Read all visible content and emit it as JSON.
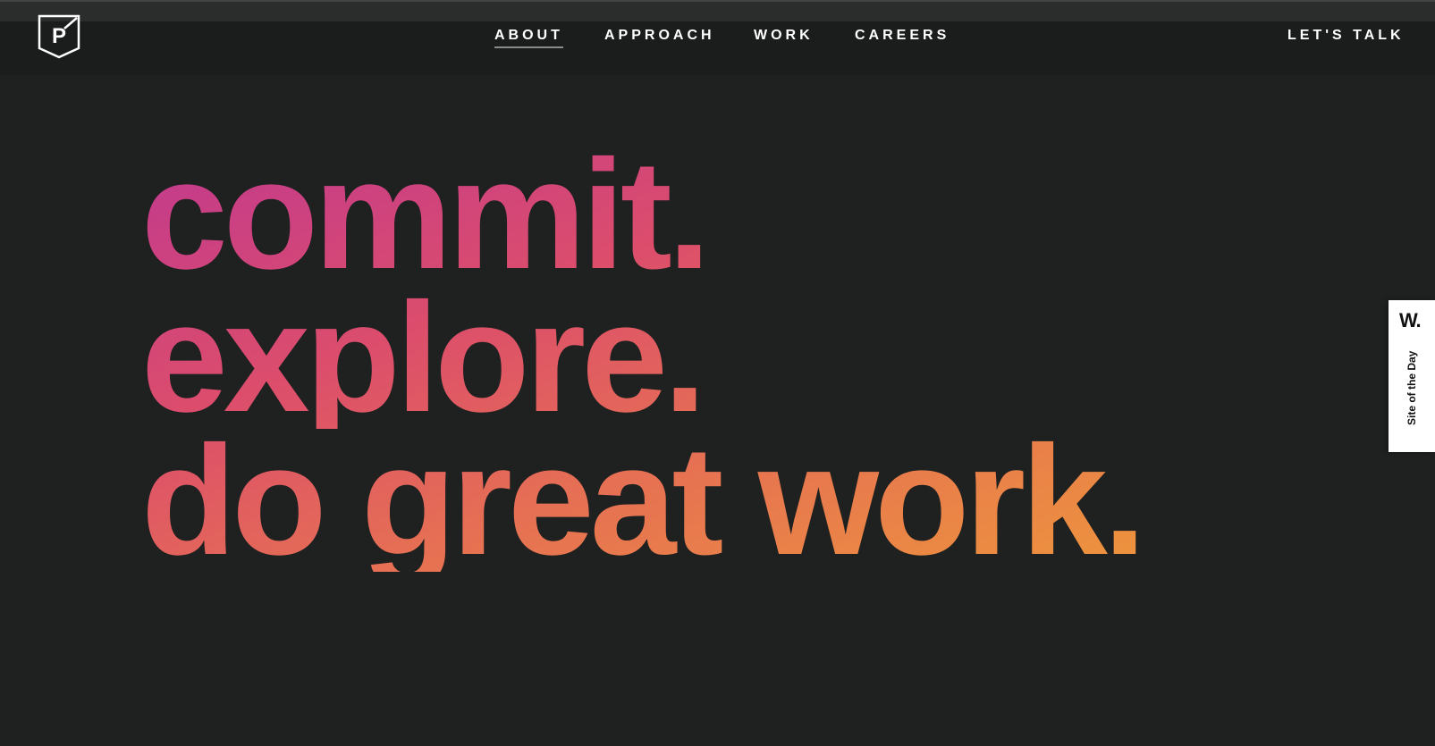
{
  "brand": {
    "logo_letter": "P",
    "logo_icon": "shield-p-logo-icon"
  },
  "nav": {
    "items": [
      {
        "label": "ABOUT",
        "active": true
      },
      {
        "label": "APPROACH",
        "active": false
      },
      {
        "label": "WORK",
        "active": false
      },
      {
        "label": "CAREERS",
        "active": false
      }
    ],
    "cta": "LET'S TALK"
  },
  "hero": {
    "lines": [
      "commit.",
      "explore.",
      "do great work."
    ],
    "gradient": [
      "#c0398f",
      "#dc4d6c",
      "#e56d55",
      "#ee993a"
    ]
  },
  "badge": {
    "mark": "W.",
    "label": "Site of the Day"
  },
  "colors": {
    "background": "#1f2020",
    "navbar": "#1b1c1c",
    "text": "#ffffff"
  }
}
